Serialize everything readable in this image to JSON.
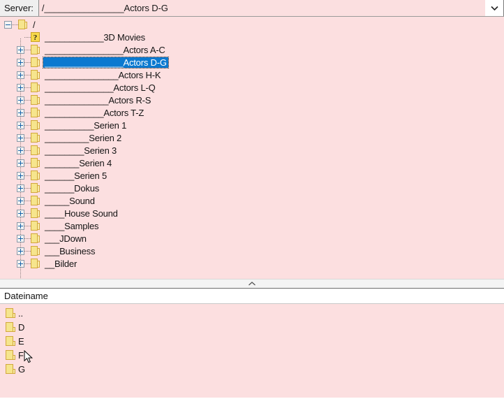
{
  "window": {
    "background_pink": "#fcdfe0",
    "selection_blue": "#0b79d0"
  },
  "server_bar": {
    "label": "Server:",
    "value": "/________________Actors D-G",
    "placeholder": "",
    "dropdown_icon": "chevron-down-icon"
  },
  "tree": {
    "root": {
      "label": "/",
      "expander": "minus",
      "icon": "folder-icon"
    },
    "items": [
      {
        "label": "____________3D Movies",
        "icon": "question-icon",
        "expander": "none",
        "selected": false
      },
      {
        "label": "________________Actors A-C",
        "icon": "folder-icon",
        "expander": "plus",
        "selected": false
      },
      {
        "label": "________________Actors D-G",
        "icon": "folder-icon",
        "expander": "plus",
        "selected": true
      },
      {
        "label": "_______________Actors H-K",
        "icon": "folder-icon",
        "expander": "plus",
        "selected": false
      },
      {
        "label": "______________Actors L-Q",
        "icon": "folder-icon",
        "expander": "plus",
        "selected": false
      },
      {
        "label": "_____________Actors R-S",
        "icon": "folder-icon",
        "expander": "plus",
        "selected": false
      },
      {
        "label": "____________Actors T-Z",
        "icon": "folder-icon",
        "expander": "plus",
        "selected": false
      },
      {
        "label": "__________Serien 1",
        "icon": "folder-icon",
        "expander": "plus",
        "selected": false
      },
      {
        "label": "_________Serien 2",
        "icon": "folder-icon",
        "expander": "plus",
        "selected": false
      },
      {
        "label": "________Serien 3",
        "icon": "folder-icon",
        "expander": "plus",
        "selected": false
      },
      {
        "label": "_______Serien 4",
        "icon": "folder-icon",
        "expander": "plus",
        "selected": false
      },
      {
        "label": "______Serien 5",
        "icon": "folder-icon",
        "expander": "plus",
        "selected": false
      },
      {
        "label": "______Dokus",
        "icon": "folder-icon",
        "expander": "plus",
        "selected": false
      },
      {
        "label": "_____Sound",
        "icon": "folder-icon",
        "expander": "plus",
        "selected": false
      },
      {
        "label": "____House Sound",
        "icon": "folder-icon",
        "expander": "plus",
        "selected": false
      },
      {
        "label": "____Samples",
        "icon": "folder-icon",
        "expander": "plus",
        "selected": false
      },
      {
        "label": "___JDown",
        "icon": "folder-icon",
        "expander": "plus",
        "selected": false
      },
      {
        "label": "___Business",
        "icon": "folder-icon",
        "expander": "plus",
        "selected": false
      },
      {
        "label": "__Bilder",
        "icon": "folder-icon",
        "expander": "plus",
        "selected": false
      }
    ]
  },
  "splitter": {
    "icon": "chevron-up-icon"
  },
  "file_panel": {
    "header": "Dateiname",
    "rows": [
      {
        "name": "..",
        "icon": "folder-icon"
      },
      {
        "name": "D",
        "icon": "folder-icon"
      },
      {
        "name": "E",
        "icon": "folder-icon"
      },
      {
        "name": "F",
        "icon": "folder-icon"
      },
      {
        "name": "G",
        "icon": "folder-icon"
      }
    ]
  }
}
